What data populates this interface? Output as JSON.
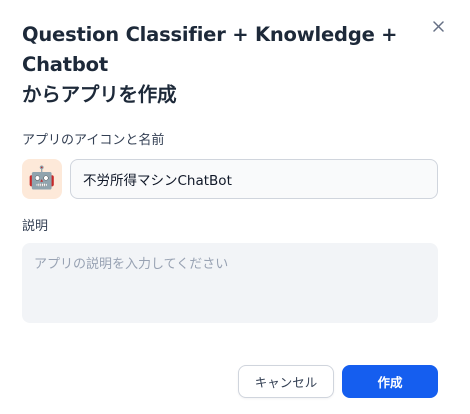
{
  "dialog": {
    "title_line1": "Question Classifier + Knowledge + Chatbot",
    "title_line2": "からアプリを作成"
  },
  "name_section": {
    "label": "アプリのアイコンと名前",
    "icon": "robot-emoji",
    "icon_glyph": "🤖",
    "icon_bg": "#fde9d9",
    "name_value": "不労所得マシンChatBot"
  },
  "description_section": {
    "label": "説明",
    "placeholder": "アプリの説明を入力してください"
  },
  "actions": {
    "cancel_label": "キャンセル",
    "create_label": "作成"
  },
  "colors": {
    "primary": "#155eef",
    "title": "#1d2939"
  }
}
